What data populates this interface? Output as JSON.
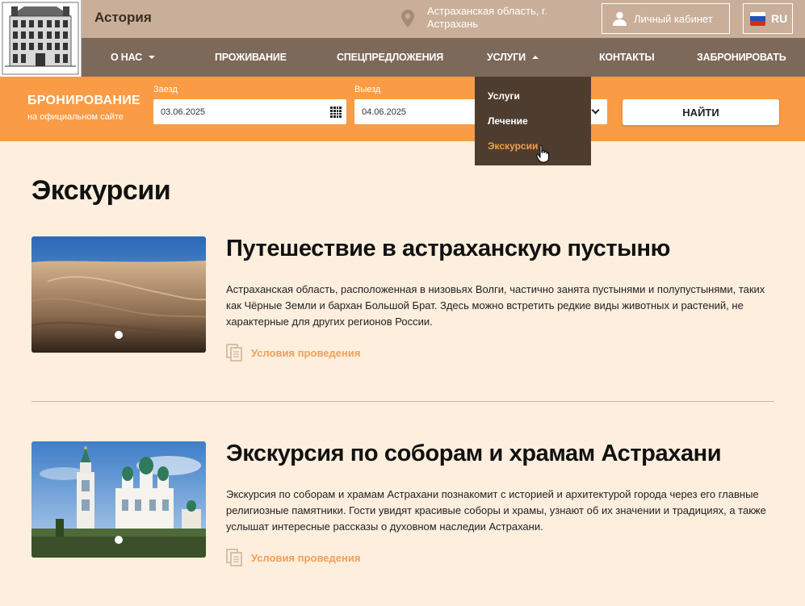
{
  "header": {
    "hotel_name": "Астория",
    "location": "Астраханская область, г. Астрахань",
    "cabinet_label": "Личный кабинет",
    "language": "RU"
  },
  "nav": {
    "about": "О НАС",
    "living": "ПРОЖИВАНИЕ",
    "offers": "СПЕЦПРЕДЛОЖЕНИЯ",
    "services": "УСЛУГИ",
    "contacts": "КОНТАКТЫ",
    "book": "ЗАБРОНИРОВАТЬ"
  },
  "dropdown": {
    "items": [
      "Услуги",
      "Лечение",
      "Экскурсии"
    ],
    "active_index": 2
  },
  "booking": {
    "title": "БРОНИРОВАНИЕ",
    "subtitle": "на официальном сайте",
    "checkin_label": "Заезд",
    "checkin_value": "03.06.2025",
    "checkout_label": "Выезд",
    "checkout_value": "04.06.2025",
    "find_label": "НАЙТИ"
  },
  "page": {
    "title": "Экскурсии",
    "excursions": [
      {
        "title": "Путешествие в астраханскую пустыню",
        "description": "Астраханская область, расположенная в низовьях Волги, частично занята пустынями и полупустынями, таких как Чёрные Земли и бархан Большой Брат. Здесь можно встретить редкие виды животных и растений, не характерные для других регионов России.",
        "link": "Условия проведения"
      },
      {
        "title": "Экскурсия по соборам и храмам Астрахани",
        "description": "Экскурсия по соборам и храмам Астрахани познакомит с историей и архитектурой города через его главные религиозные памятники. Гости увидят красивые соборы и храмы, узнают об их значении и традициях, а также услышат интересные рассказы о духовном наследии Астрахани.",
        "link": "Условия проведения"
      }
    ]
  },
  "colors": {
    "topbar": "#c9af99",
    "navbar": "#7d6959",
    "booking": "#f99c45",
    "dropdown": "#4e3d2f",
    "accent": "#f99c45",
    "background": "#fdeedd"
  }
}
